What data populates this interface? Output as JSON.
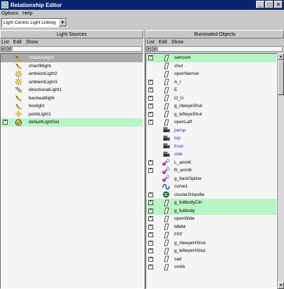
{
  "window": {
    "title": "Relationship Editor",
    "min_glyph": "_",
    "max_glyph": "□",
    "close_glyph": "×"
  },
  "menubar": {
    "options": "Options",
    "help": "Help"
  },
  "mode": {
    "selected": "Light Centric Light Linking",
    "arrow_glyph": "▼"
  },
  "left_panel": {
    "title": "Light Sources",
    "menu": [
      "List",
      "Edit",
      "Show"
    ],
    "filter_left": "▸",
    "filter_right": "◂",
    "items": [
      {
        "label": "chackeylight",
        "icon": "spotlight-icon",
        "state": "gray",
        "expand": false
      },
      {
        "label": "chacfilllight",
        "icon": "spotlight-icon",
        "state": "",
        "expand": false
      },
      {
        "label": "ambientLight2",
        "icon": "ambient-light-icon",
        "state": "",
        "expand": false
      },
      {
        "label": "ambientLight3",
        "icon": "ambient-light-icon",
        "state": "",
        "expand": false
      },
      {
        "label": "directionalLight1",
        "icon": "directional-light-icon",
        "state": "",
        "expand": false
      },
      {
        "label": "backwalllight",
        "icon": "spotlight-icon",
        "state": "",
        "expand": false
      },
      {
        "label": "boxlight",
        "icon": "spotlight-icon",
        "state": "",
        "expand": false
      },
      {
        "label": "pointLight1",
        "icon": "point-light-icon",
        "state": "",
        "expand": false
      },
      {
        "label": "defaultLightSet",
        "icon": "light-set-icon",
        "state": "green",
        "expand": true
      }
    ]
  },
  "right_panel": {
    "title": "Illuminated Objects",
    "menu": [
      "List",
      "Edit",
      "Show"
    ],
    "filter_left": "▸",
    "filter_right": "◂",
    "scroll_up": "▲",
    "scroll_down": "▼",
    "items": [
      {
        "label": "setroom",
        "icon": "transform-icon",
        "state": "green",
        "expand": true
      },
      {
        "label": "shut",
        "icon": "transform-icon",
        "state": "",
        "expand": false
      },
      {
        "label": "openNarrow",
        "icon": "transform-icon",
        "state": "",
        "expand": false
      },
      {
        "label": "A_I",
        "icon": "transform-icon",
        "state": "",
        "expand": true
      },
      {
        "label": "E",
        "icon": "transform-icon",
        "state": "",
        "expand": true
      },
      {
        "label": "O_U",
        "icon": "transform-icon",
        "state": "",
        "expand": true
      },
      {
        "label": "g_riteeyeShut",
        "icon": "transform-icon",
        "state": "",
        "expand": true
      },
      {
        "label": "g_lefteyeShut",
        "icon": "transform-icon",
        "state": "",
        "expand": true
      },
      {
        "label": "openLaff",
        "icon": "transform-icon",
        "state": "",
        "expand": true
      },
      {
        "label": "persp",
        "icon": "camera-icon",
        "state": "",
        "expand": false,
        "cam": true
      },
      {
        "label": "top",
        "icon": "camera-icon",
        "state": "",
        "expand": false,
        "cam": true
      },
      {
        "label": "front",
        "icon": "camera-icon",
        "state": "",
        "expand": false,
        "cam": true
      },
      {
        "label": "side",
        "icon": "camera-icon",
        "state": "",
        "expand": false,
        "cam": true
      },
      {
        "label": "L_armIK",
        "icon": "ik-handle-icon",
        "state": "",
        "expand": true
      },
      {
        "label": "R_armIK",
        "icon": "ik-handle-icon",
        "state": "",
        "expand": true
      },
      {
        "label": "g_backSpline",
        "icon": "ik-handle-icon",
        "state": "",
        "expand": false
      },
      {
        "label": "curve1",
        "icon": "curve-icon",
        "state": "",
        "expand": false
      },
      {
        "label": "cluster2Handle",
        "icon": "cluster-icon",
        "state": "",
        "expand": true
      },
      {
        "label": "g_fullbodyCtrl",
        "icon": "transform-icon",
        "state": "green",
        "expand": true
      },
      {
        "label": "g_fullbody",
        "icon": "transform-icon",
        "state": "green",
        "expand": true
      },
      {
        "label": "openWide",
        "icon": "transform-icon",
        "state": "",
        "expand": true
      },
      {
        "label": "MMM",
        "icon": "transform-icon",
        "state": "",
        "expand": true
      },
      {
        "label": "FFF",
        "icon": "transform-icon",
        "state": "",
        "expand": true
      },
      {
        "label": "g_riteeyeHShut",
        "icon": "transform-icon",
        "state": "",
        "expand": true
      },
      {
        "label": "g_lefteyeHShut",
        "icon": "transform-icon",
        "state": "",
        "expand": true
      },
      {
        "label": "sad",
        "icon": "transform-icon",
        "state": "",
        "expand": true
      },
      {
        "label": "smirk",
        "icon": "transform-icon",
        "state": "",
        "expand": true
      }
    ]
  },
  "colors": {
    "title_bar": "#0a246a",
    "selected_gray": "#a9a9a9",
    "selected_green": "#b9f5c4",
    "camera_text": "#1f2fbf"
  }
}
